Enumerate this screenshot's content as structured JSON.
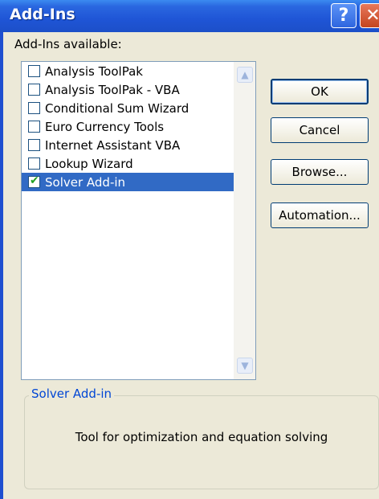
{
  "window": {
    "title": "Add-Ins",
    "help_label": "?",
    "close_label": "✕"
  },
  "list": {
    "label": "Add-Ins available:",
    "items": [
      {
        "label": "Analysis ToolPak",
        "checked": false,
        "selected": false
      },
      {
        "label": "Analysis ToolPak - VBA",
        "checked": false,
        "selected": false
      },
      {
        "label": "Conditional Sum Wizard",
        "checked": false,
        "selected": false
      },
      {
        "label": "Euro Currency Tools",
        "checked": false,
        "selected": false
      },
      {
        "label": "Internet Assistant VBA",
        "checked": false,
        "selected": false
      },
      {
        "label": "Lookup Wizard",
        "checked": false,
        "selected": false
      },
      {
        "label": "Solver Add-in",
        "checked": true,
        "selected": true
      }
    ],
    "scroll_up_icon": "▲",
    "scroll_down_icon": "▼"
  },
  "buttons": {
    "ok": "OK",
    "cancel": "Cancel",
    "browse": "Browse...",
    "automation": "Automation..."
  },
  "description": {
    "title": "Solver Add-in",
    "text": "Tool for optimization and equation solving"
  },
  "colors": {
    "titlebar": "#1f55d6",
    "selection": "#316ac5",
    "dialog_bg": "#ece9d8"
  }
}
